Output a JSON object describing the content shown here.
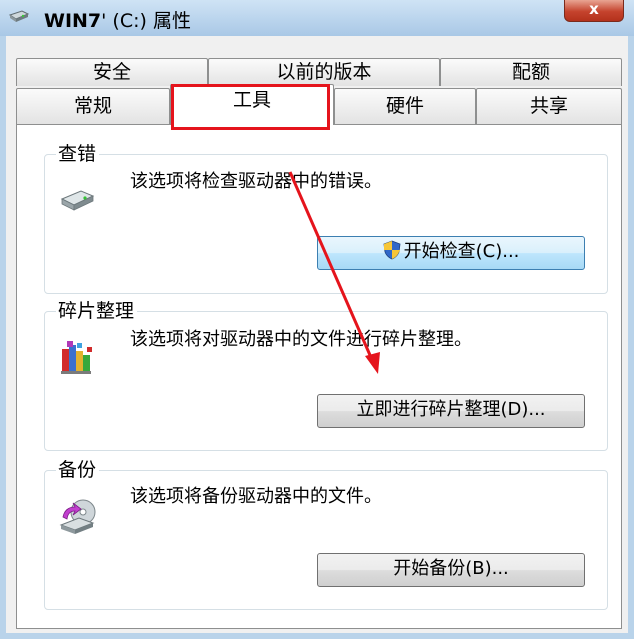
{
  "window": {
    "title_bold": "WIN7",
    "title_rest": "' (C:) 属性",
    "close_label": "x"
  },
  "tabs": {
    "row1": [
      "安全",
      "以前的版本",
      "配额"
    ],
    "row2": [
      "常规",
      "工具",
      "硬件",
      "共享"
    ],
    "active": "工具"
  },
  "groups": {
    "check": {
      "title": "查错",
      "description": "该选项将检查驱动器中的错误。",
      "button": "开始检查(C)..."
    },
    "defrag": {
      "title": "碎片整理",
      "description": "该选项将对驱动器中的文件进行碎片整理。",
      "button": "立即进行碎片整理(D)..."
    },
    "backup": {
      "title": "备份",
      "description": "该选项将备份驱动器中的文件。",
      "button": "开始备份(B)..."
    }
  },
  "icons": {
    "title": "drive-icon",
    "check": "hard-drive-icon",
    "defrag": "disk-defragmenter-icon",
    "backup": "backup-icon",
    "shield": "uac-shield-icon"
  },
  "colors": {
    "annotation_red": "#e5141c",
    "primary_button": "#bee6fd"
  }
}
